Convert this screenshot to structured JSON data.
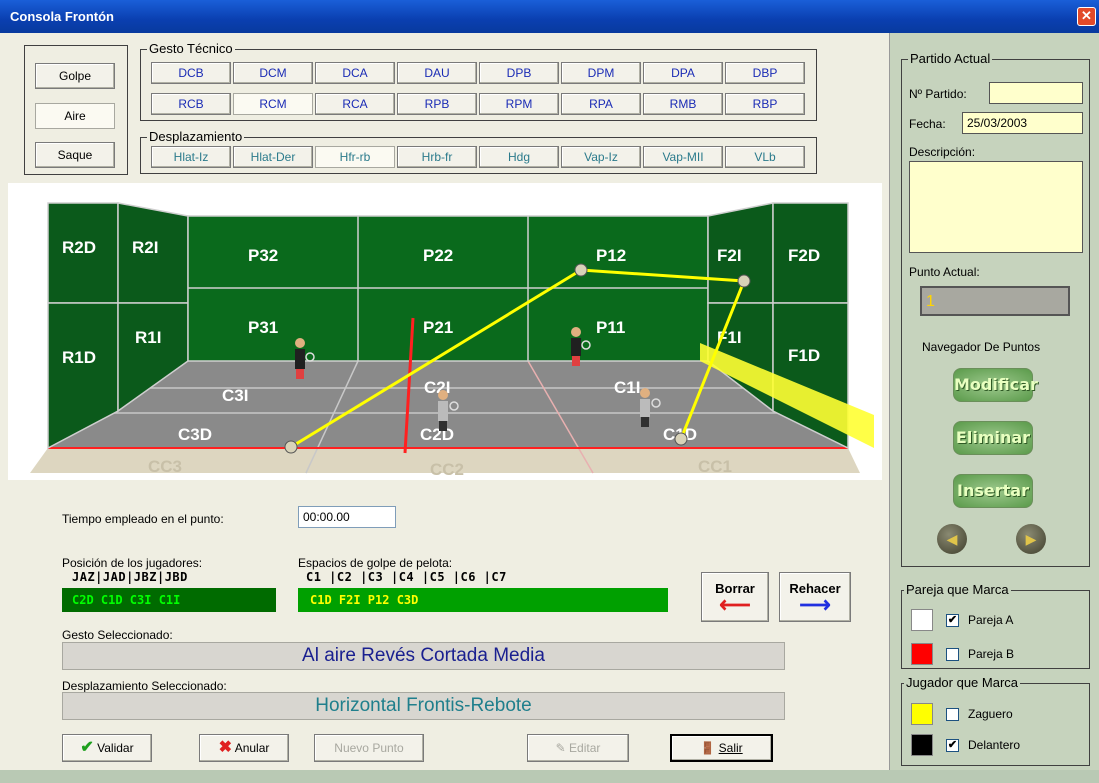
{
  "window": {
    "title": "Consola Frontón",
    "close_glyph": "✕"
  },
  "mode_buttons": [
    "Golpe",
    "Aire",
    "Saque"
  ],
  "gesto": {
    "title": "Gesto Técnico",
    "row1": [
      "DCB",
      "DCM",
      "DCA",
      "DAU",
      "DPB",
      "DPM",
      "DPA",
      "DBP"
    ],
    "row2": [
      "RCB",
      "RCM",
      "RCA",
      "RPB",
      "RPM",
      "RPA",
      "RMB",
      "RBP"
    ]
  },
  "desplazamiento": {
    "title": "Desplazamiento",
    "items": [
      "Hlat-Iz",
      "Hlat-Der",
      "Hfr-rb",
      "Hrb-fr",
      "Hdg",
      "Vap-Iz",
      "Vap-MII",
      "VLb"
    ]
  },
  "court": {
    "left_wall": [
      "R2D",
      "R2I",
      "R1I",
      "R1D"
    ],
    "front_wall": [
      "P32",
      "P22",
      "P12",
      "P31",
      "P21",
      "P11"
    ],
    "right_wall": [
      "F2I",
      "F2D",
      "F1I",
      "F1D"
    ],
    "floor": [
      "C3I",
      "C2I",
      "C1I",
      "C3D",
      "C2D",
      "C1D"
    ],
    "zones": [
      "CC3",
      "CC2",
      "CC1"
    ],
    "ball_color": "#d8d2b8",
    "trajectory_color": "#ffff00"
  },
  "tiempo": {
    "label": "Tiempo empleado en el punto:",
    "value": "00:00.00"
  },
  "posicion": {
    "label": "Posición de los jugadores:",
    "header": "JAZ|JAD|JBZ|JBD",
    "values": "C2D C1D C3I C1I"
  },
  "espacios": {
    "label": "Espacios  de golpe de pelota:",
    "header": "C1 |C2 |C3 |C4 |C5 |C6 |C7",
    "values": "C1D F2I P12 C3D"
  },
  "borrar": "Borrar",
  "rehacer": "Rehacer",
  "gesto_sel": {
    "label": "Gesto Seleccionado:",
    "value": "Al aire Revés Cortada Media"
  },
  "despl_sel": {
    "label": "Desplazamiento Seleccionado:",
    "value": "Horizontal Frontis-Rebote"
  },
  "bottom_buttons": {
    "validar": "Validar",
    "anular": "Anular",
    "nuevo": "Nuevo Punto",
    "editar": "Editar",
    "salir": "Salir"
  },
  "partido": {
    "title": "Partido Actual",
    "num_label": "Nº Partido:",
    "num_value": "",
    "fecha_label": "Fecha:",
    "fecha_value": "25/03/2003",
    "desc_label": "Descripción:",
    "desc_value": "",
    "punto_label": "Punto Actual:",
    "punto_value": "1",
    "navegador_label": "Navegador De Puntos",
    "modificar": "Modificar",
    "eliminar": "Eliminar",
    "insertar": "Insertar"
  },
  "pareja": {
    "title": "Pareja que Marca",
    "a": "Pareja A",
    "a_checked": true,
    "b": "Pareja B",
    "b_checked": false
  },
  "jugador": {
    "title": "Jugador que Marca",
    "zaguero": "Zaguero",
    "zaguero_checked": false,
    "delantero": "Delantero",
    "delantero_checked": true
  }
}
